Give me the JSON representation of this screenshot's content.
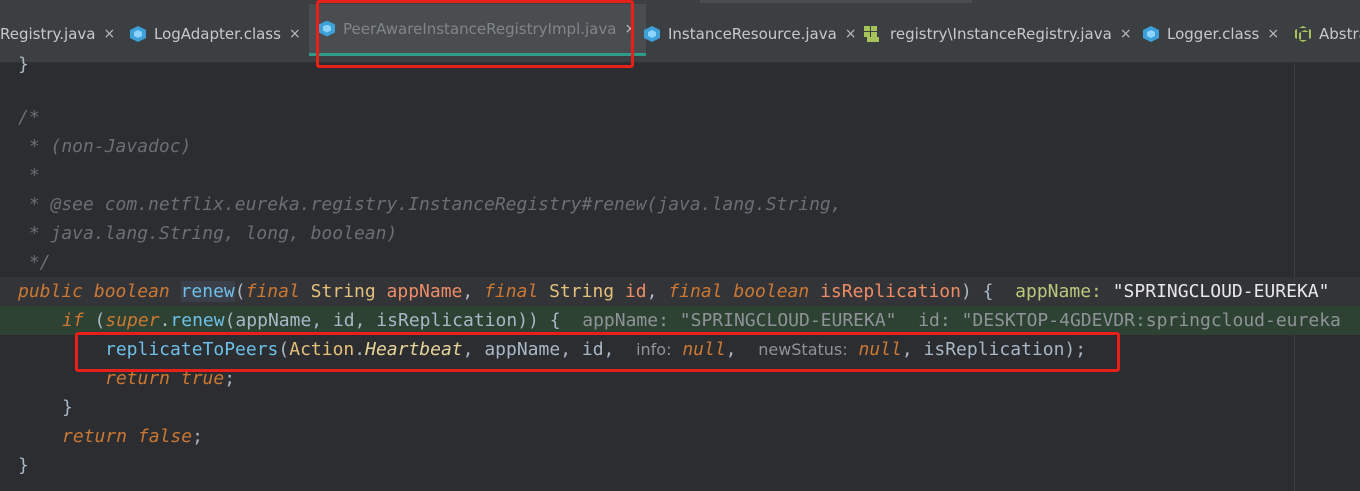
{
  "tabs": [
    {
      "label": "Registry.java",
      "icon": "class-icon"
    },
    {
      "label": "LogAdapter.class",
      "icon": "class-icon"
    },
    {
      "label": "PeerAwareInstanceRegistryImpl.java",
      "icon": "class-icon",
      "active": true
    },
    {
      "label": "InstanceResource.java",
      "icon": "class-icon"
    },
    {
      "label": "registry\\InstanceRegistry.java",
      "icon": "module-icon"
    },
    {
      "label": "Logger.class",
      "icon": "class-icon"
    },
    {
      "label": "Abstra",
      "icon": "interface-icon"
    }
  ],
  "close_glyph": "×",
  "code": {
    "l0": "}",
    "l2": "/*",
    "l3": " * (non-Javadoc)",
    "l4": " *",
    "l5": " * @see com.netflix.eureka.registry.InstanceRegistry#renew(java.lang.String,",
    "l6": " * java.lang.String, long, boolean)",
    "l7": " */",
    "sig": {
      "kw1": "public",
      "kw2": "boolean",
      "fn": "renew",
      "p1": "(",
      "kw3": "final",
      "t1": "String",
      "a1": "appName",
      "comma1": ",",
      "kw4": "final",
      "t2": "String",
      "a2": "id",
      "comma2": ",",
      "kw5": "final",
      "kw6": "boolean",
      "a3": "isReplication",
      "end": ") {",
      "hint_name": "appName:",
      "hint_val": "\"SPRINGCLOUD-EUREKA\""
    },
    "ifl": {
      "kw": "if",
      "open": "(",
      "sup": "super",
      "dot": ".",
      "fn": "renew",
      "args": "(appName, id, isReplication)) {",
      "h1_name": "appName:",
      "h1_val": "\"SPRINGCLOUD-EUREKA\"",
      "h2_name": "id:",
      "h2_val": "\"DESKTOP-4GDEVDR:springcloud-eureka"
    },
    "rep": {
      "fn": "replicateToPeers",
      "open": "(",
      "cls": "Action",
      "dot": ".",
      "member": "Heartbeat",
      "args": ", appName, id, ",
      "h_info": "info:",
      "v_null1": "null",
      "comma": ",",
      "h_status": "newStatus:",
      "v_null2": "null",
      "tail": ", isReplication);"
    },
    "ret_true": {
      "kw": "return",
      "val": "true",
      "semi": ";"
    },
    "brace_inner": "}",
    "ret_false": {
      "kw": "return",
      "val": "false",
      "semi": ";"
    },
    "brace_outer": "}"
  },
  "colors": {
    "highlight_box": "#e8201a",
    "active_tab_underline": "#2e9c88"
  }
}
